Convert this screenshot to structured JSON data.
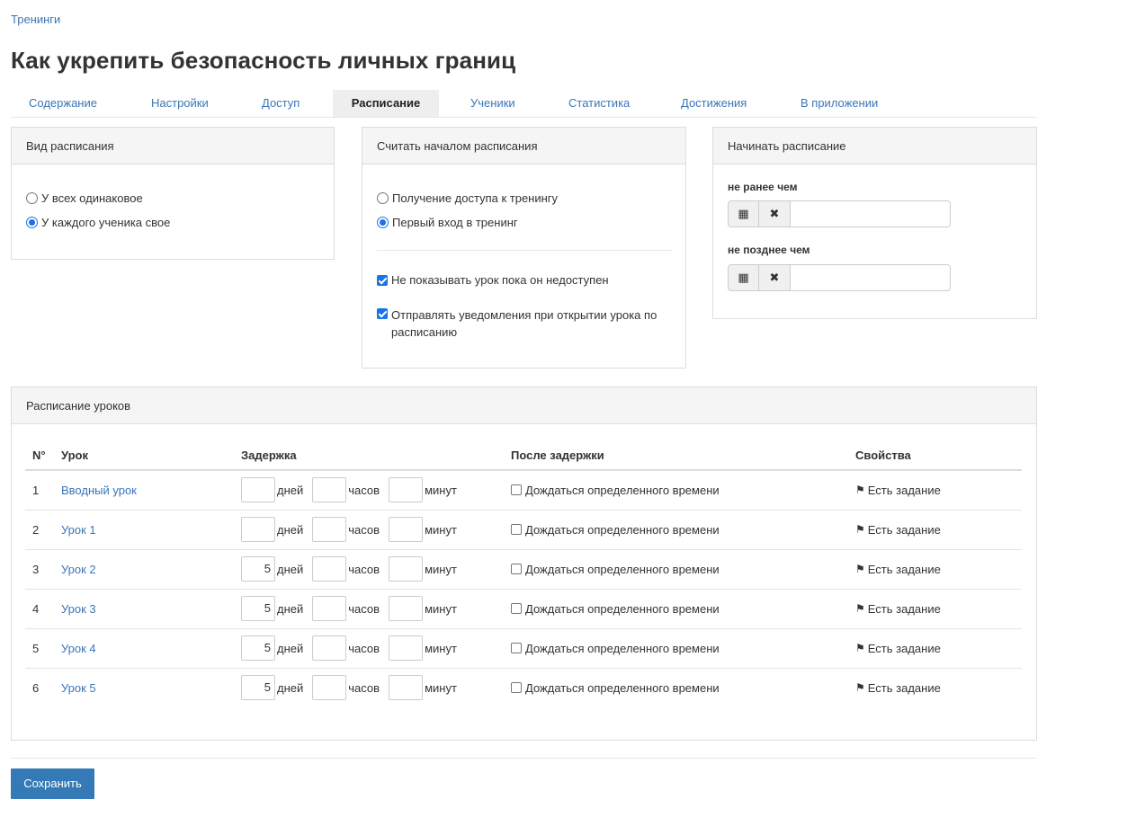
{
  "breadcrumb": "Тренинги",
  "page_title": "Как укрепить безопасность личных границ",
  "tabs": [
    "Содержание",
    "Настройки",
    "Доступ",
    "Расписание",
    "Ученики",
    "Статистика",
    "Достижения",
    "В приложении"
  ],
  "active_tab": "Расписание",
  "schedule_type": {
    "title": "Вид расписания",
    "options": [
      "У всех одинаковое",
      "У каждого ученика свое"
    ],
    "selected": "У каждого ученика свое"
  },
  "schedule_start": {
    "title": "Считать началом расписания",
    "options": [
      "Получение доступа к тренингу",
      "Первый вход в тренинг"
    ],
    "selected": "Первый вход в тренинг",
    "checkboxes": [
      {
        "label": "Не показывать урок пока он недоступен",
        "checked": true
      },
      {
        "label": "Отправлять уведомления при открытии урока по расписанию",
        "checked": true
      }
    ]
  },
  "begin_schedule": {
    "title": "Начинать расписание",
    "not_earlier_label": "не ранее чем",
    "not_later_label": "не позднее чем",
    "not_earlier_value": "",
    "not_later_value": ""
  },
  "lessons_schedule": {
    "title": "Расписание уроков",
    "headers": {
      "num": "N°",
      "lesson": "Урок",
      "delay": "Задержка",
      "after": "После задержки",
      "props": "Свойства"
    },
    "units": {
      "days": "дней",
      "hours": "часов",
      "minutes": "минут"
    },
    "after_label": "Дождаться определенного времени",
    "prop_label": "Есть задание",
    "rows": [
      {
        "num": "1",
        "lesson": "Вводный урок",
        "days": "",
        "hours": "",
        "minutes": "",
        "wait": false
      },
      {
        "num": "2",
        "lesson": "Урок 1",
        "days": "",
        "hours": "",
        "minutes": "",
        "wait": false
      },
      {
        "num": "3",
        "lesson": "Урок 2",
        "days": "5",
        "hours": "",
        "minutes": "",
        "wait": false
      },
      {
        "num": "4",
        "lesson": "Урок 3",
        "days": "5",
        "hours": "",
        "minutes": "",
        "wait": false
      },
      {
        "num": "5",
        "lesson": "Урок 4",
        "days": "5",
        "hours": "",
        "minutes": "",
        "wait": false
      },
      {
        "num": "6",
        "lesson": "Урок 5",
        "days": "5",
        "hours": "",
        "minutes": "",
        "wait": false
      }
    ]
  },
  "save_label": "Сохранить"
}
